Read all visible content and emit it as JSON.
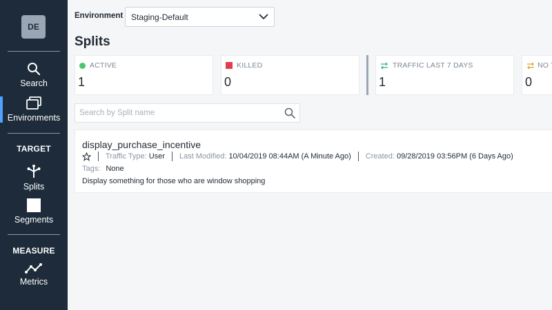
{
  "sidebar": {
    "avatar_initials": "DE",
    "items": [
      {
        "label": "Search",
        "icon": "search-icon"
      },
      {
        "label": "Environments",
        "icon": "environments-icon"
      },
      {
        "label": "Splits",
        "icon": "splits-icon"
      },
      {
        "label": "Segments",
        "icon": "segments-icon"
      },
      {
        "label": "Metrics",
        "icon": "metrics-icon"
      }
    ],
    "sections": {
      "target": "TARGET",
      "measure": "MEASURE"
    },
    "active_color": "#4da3ff"
  },
  "environment": {
    "label": "Environment",
    "selected": "Staging-Default"
  },
  "page": {
    "title": "Splits"
  },
  "stats": [
    {
      "label": "ACTIVE",
      "value": "1",
      "color": "#4cc46e"
    },
    {
      "label": "KILLED",
      "value": "0",
      "color": "#e03e4f"
    },
    {
      "label": "TRAFFIC LAST 7 DAYS",
      "value": "1",
      "color": "#3fb08f"
    },
    {
      "label": "NO T",
      "value": "0",
      "color": "#e0a82e"
    }
  ],
  "search": {
    "placeholder": "Search by Split name"
  },
  "splits": [
    {
      "name": "display_purchase_incentive",
      "traffic_type_label": "Traffic Type:",
      "traffic_type": "User",
      "last_modified_label": "Last Modified:",
      "last_modified": "10/04/2019 08:44AM (A Minute Ago)",
      "created_label": "Created:",
      "created": "09/28/2019 03:56PM (6 Days Ago)",
      "tags_label": "Tags:",
      "tags": "None",
      "description": "Display something for those who are window shopping"
    }
  ]
}
